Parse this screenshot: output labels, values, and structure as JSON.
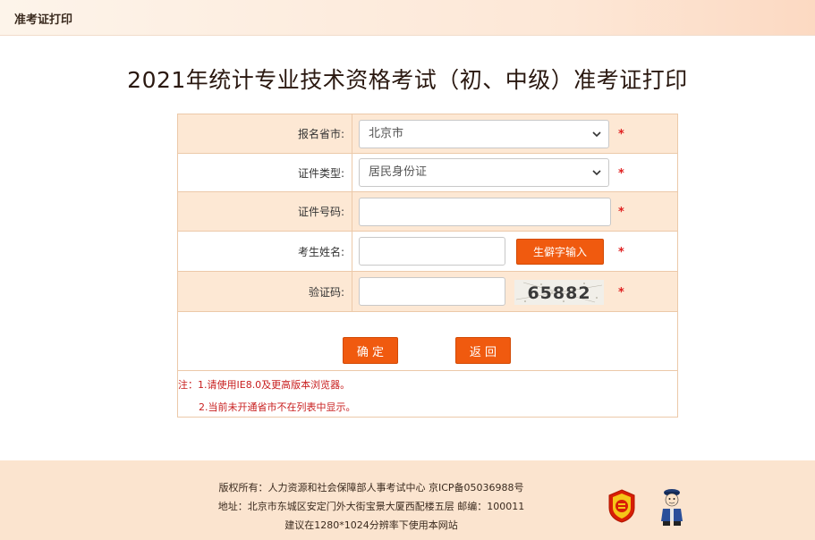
{
  "header": {
    "title": "准考证打印"
  },
  "page": {
    "title": "2021年统计专业技术资格考试（初、中级）准考证打印"
  },
  "form": {
    "province": {
      "label": "报名省市:",
      "value": "北京市"
    },
    "cert_type": {
      "label": "证件类型:",
      "value": "居民身份证"
    },
    "cert_no": {
      "label": "证件号码:",
      "value": ""
    },
    "name": {
      "label": "考生姓名:",
      "value": "",
      "rare_char_button": "生僻字输入"
    },
    "captcha": {
      "label": "验证码:",
      "value": "",
      "image_text": "65882"
    },
    "required_mark": "*",
    "confirm_button": "确 定",
    "back_button": "返 回"
  },
  "notes": {
    "line1": "注：1.请使用IE8.0及更高版本浏览器。",
    "line2": "2.当前未开通省市不在列表中显示。"
  },
  "footer": {
    "copyright": "版权所有：人力资源和社会保障部人事考试中心 京ICP备05036988号",
    "address": "地址：北京市东城区安定门外大街宝景大厦西配楼五层 邮编：100011",
    "advice": "建议在1280*1024分辨率下使用本网站"
  },
  "colors": {
    "accent": "#f05a0f",
    "row_highlight": "#fde8d4",
    "required": "#e02020",
    "footer_bg": "#fbe4cf"
  }
}
